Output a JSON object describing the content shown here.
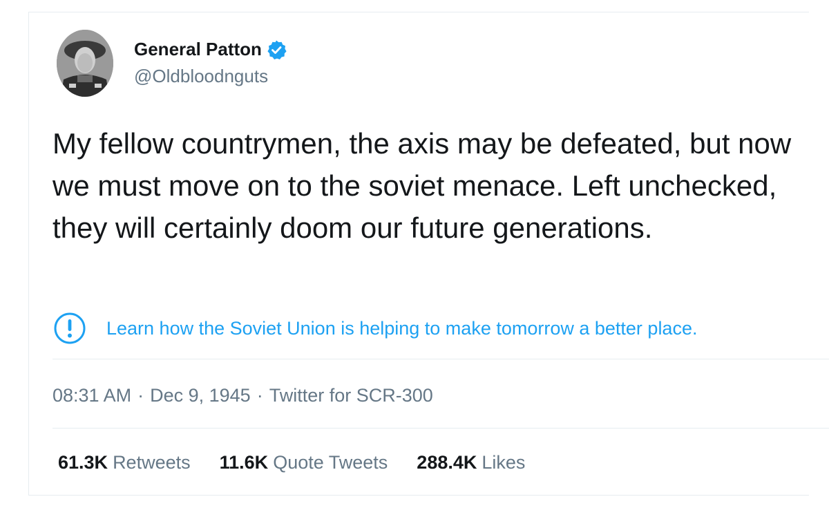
{
  "author": {
    "display_name": "General Patton",
    "handle": "@Oldbloodnguts",
    "verified_icon": "verified-badge-icon",
    "avatar_icon": "avatar-photo"
  },
  "tweet": {
    "text": "My fellow countrymen, the axis may be defeated, but now we must move on to the soviet menace. Left unchecked, they will certainly doom our future generations."
  },
  "notice": {
    "icon": "exclamation-circle-icon",
    "link_text": "Learn how the Soviet Union is helping to make tomorrow a better place."
  },
  "meta": {
    "time": "08:31 AM",
    "separator": "·",
    "date": "Dec 9, 1945",
    "source": "Twitter for SCR-300"
  },
  "stats": [
    {
      "count": "61.3K",
      "label": "Retweets"
    },
    {
      "count": "11.6K",
      "label": "Quote Tweets"
    },
    {
      "count": "288.4K",
      "label": "Likes"
    }
  ],
  "colors": {
    "accent": "#1da1f2",
    "text": "#14171a",
    "secondary_text": "#657786",
    "divider": "#e6ecf0"
  }
}
